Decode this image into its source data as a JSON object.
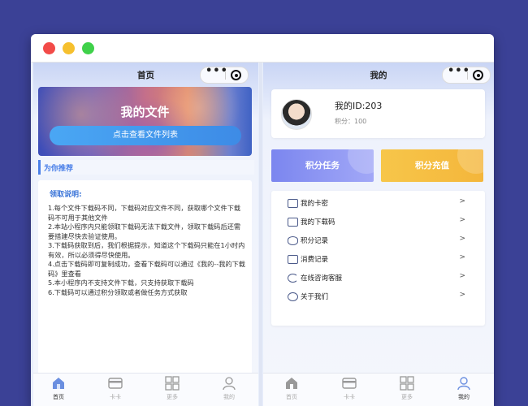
{
  "left": {
    "nav_title": "首页",
    "capsule_more": "•••",
    "banner_title": "我的文件",
    "banner_button": "点击查看文件列表",
    "section_title": "为你推荐",
    "card_title": "领取说明:",
    "instructions": [
      "1.每个文件下载码不同，下载码对应文件不同，获取哪个文件下载码不可用于其他文件",
      "2.本站小程序内只能领取下载码无法下载文件，领取下载码后还需要搭建尽快去验证使用。",
      "3.下载码获取到后，我们根据提示，知道这个下载码只能在1小时内有效，所以必须得尽快使用。",
      "4.点击下载码即可复制成功，查看下载码可以通过《我的--我的下载码》里查看",
      "5.本小程序内不支持文件下载，只支持获取下载码",
      "6.下载码可以通过积分领取或者做任务方式获取"
    ],
    "tabs": [
      {
        "label": "首页",
        "icon": "home-icon",
        "active": true
      },
      {
        "label": "卡卡",
        "icon": "card-icon",
        "active": false
      },
      {
        "label": "更多",
        "icon": "grid-icon",
        "active": false
      },
      {
        "label": "我的",
        "icon": "user-icon",
        "active": false
      }
    ]
  },
  "right": {
    "nav_title": "我的",
    "capsule_more": "•••",
    "user_id": "我的ID:203",
    "points": "积分：100",
    "task_button": "积分任务",
    "recharge_button": "积分充值",
    "menu": [
      {
        "label": "我的卡密",
        "icon": "card-icon",
        "arrow": ">"
      },
      {
        "label": "我的下载码",
        "icon": "download-code-icon",
        "arrow": ">"
      },
      {
        "label": "积分记录",
        "icon": "coins-icon",
        "arrow": ">"
      },
      {
        "label": "消费记录",
        "icon": "receipt-icon",
        "arrow": ">"
      },
      {
        "label": "在线咨询客服",
        "icon": "service-icon",
        "arrow": ">"
      },
      {
        "label": "关于我们",
        "icon": "info-icon",
        "arrow": ">"
      }
    ],
    "tabs": [
      {
        "label": "首页",
        "icon": "home-icon",
        "active": false
      },
      {
        "label": "卡卡",
        "icon": "card-icon",
        "active": false
      },
      {
        "label": "更多",
        "icon": "grid-icon",
        "active": false
      },
      {
        "label": "我的",
        "icon": "user-icon",
        "active": true
      }
    ]
  }
}
